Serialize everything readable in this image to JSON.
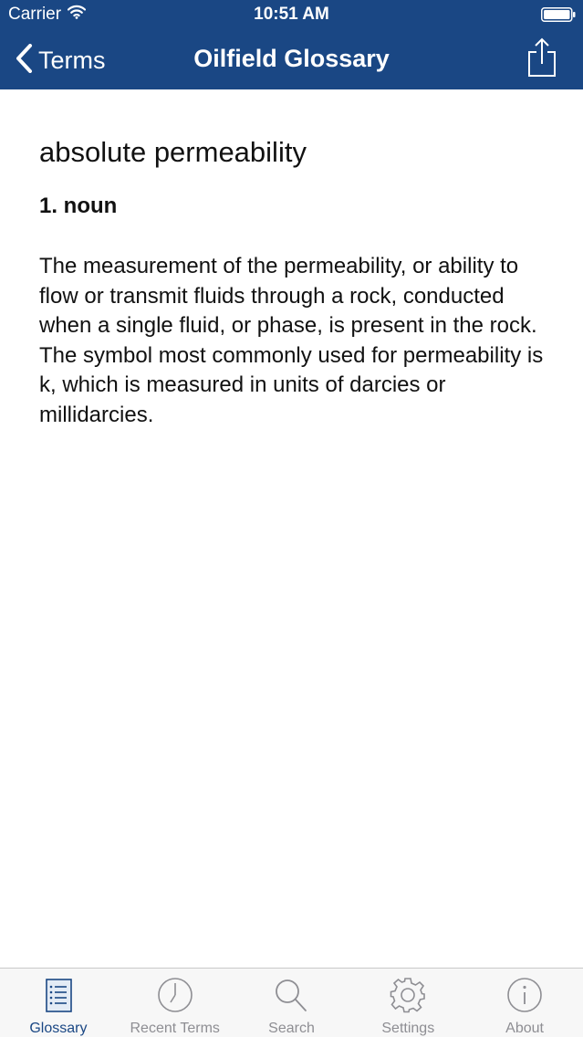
{
  "status_bar": {
    "carrier": "Carrier",
    "time": "10:51 AM"
  },
  "nav": {
    "back_label": "Terms",
    "title": "Oilfield Glossary"
  },
  "entry": {
    "term": "absolute permeability",
    "sense_label": "1. noun",
    "definition": "The measurement of the permeability, or ability to flow or transmit fluids through a rock, conducted when a single fluid, or phase, is present in the rock. The symbol most commonly used for permeability is k, which is measured in units of darcies or millidarcies."
  },
  "tabs": [
    {
      "label": "Glossary",
      "icon": "list-icon",
      "active": true
    },
    {
      "label": "Recent Terms",
      "icon": "clock-icon",
      "active": false
    },
    {
      "label": "Search",
      "icon": "search-icon",
      "active": false
    },
    {
      "label": "Settings",
      "icon": "gear-icon",
      "active": false
    },
    {
      "label": "About",
      "icon": "info-icon",
      "active": false
    }
  ],
  "colors": {
    "nav_background": "#1a4784",
    "tab_active": "#1a4784",
    "tab_inactive": "#8e8e93"
  }
}
